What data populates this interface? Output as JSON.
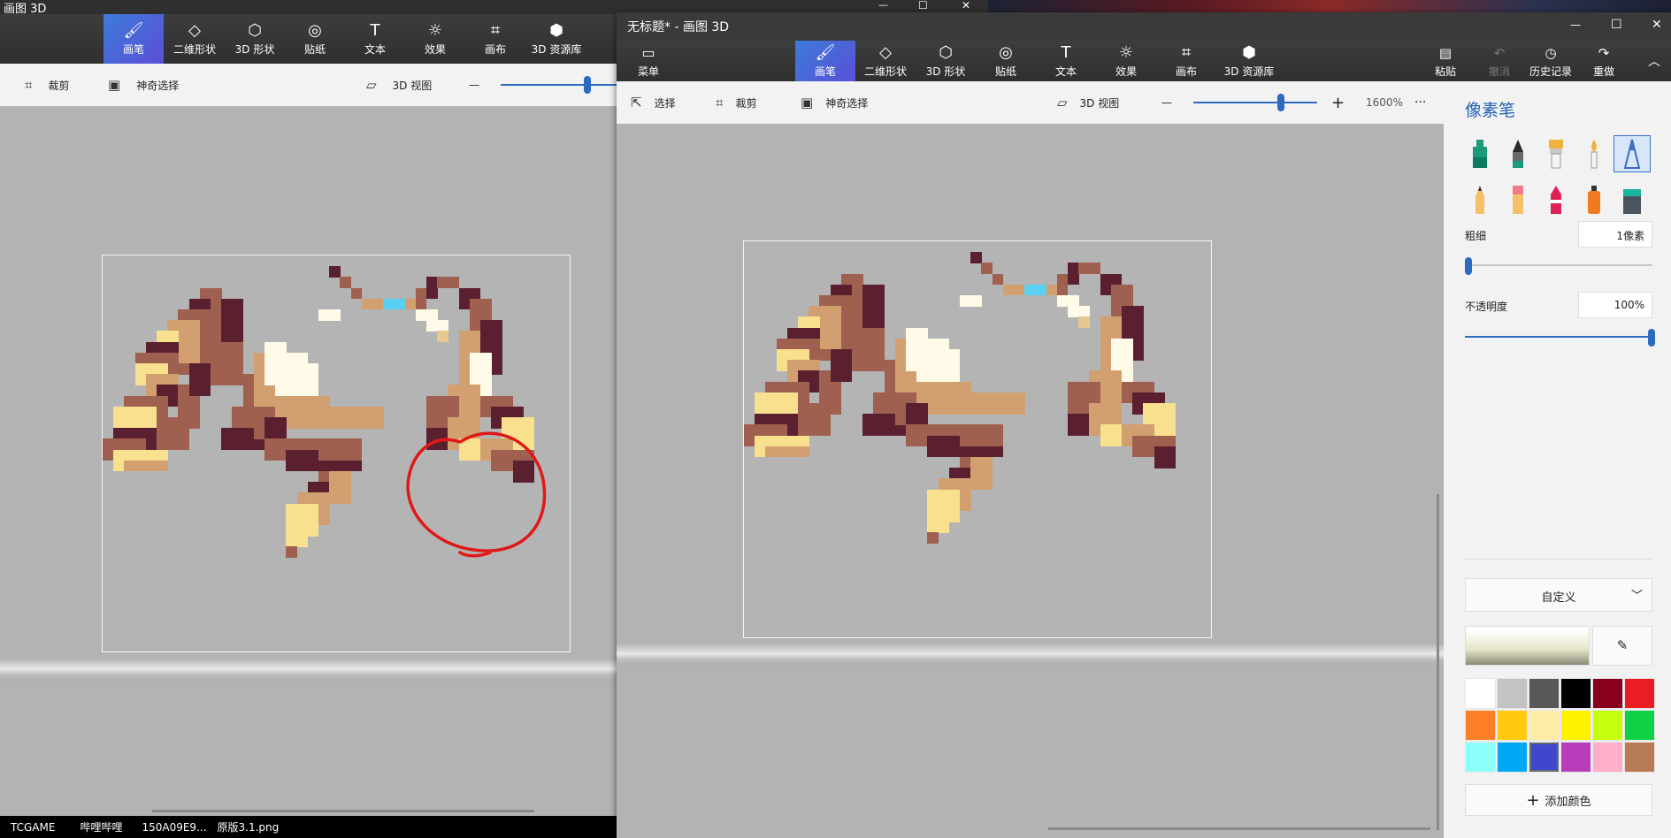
{
  "app_title_back": "画图 3D",
  "app_title_front": "无标题* - 画图 3D",
  "window_controls": {
    "minimize": "—",
    "maximize": "☐",
    "close": "✕"
  },
  "ribbon": {
    "menu_label": "菜单",
    "tools": [
      {
        "label": "画笔",
        "icon": "brush-icon"
      },
      {
        "label": "二维形状",
        "icon": "shapes-2d-icon"
      },
      {
        "label": "3D 形状",
        "icon": "cube-icon"
      },
      {
        "label": "贴纸",
        "icon": "sticker-icon"
      },
      {
        "label": "文本",
        "icon": "text-icon"
      },
      {
        "label": "效果",
        "icon": "effects-icon"
      },
      {
        "label": "画布",
        "icon": "canvas-icon"
      },
      {
        "label": "3D 资源库",
        "icon": "library-icon"
      }
    ],
    "right_tools": [
      {
        "label": "粘贴",
        "icon": "paste-icon"
      },
      {
        "label": "撤消",
        "icon": "undo-icon"
      },
      {
        "label": "历史记录",
        "icon": "history-icon"
      },
      {
        "label": "重做",
        "icon": "redo-icon"
      }
    ]
  },
  "subbar": {
    "select_label": "选择",
    "crop_label": "裁剪",
    "magic_select_label": "神奇选择",
    "view3d_label": "3D 视图",
    "zoom_minus": "—",
    "zoom_plus": "+",
    "zoom_level": "1600%",
    "more": "···"
  },
  "side_panel": {
    "title": "像素笔",
    "thickness_label": "粗细",
    "thickness_value": "1像素",
    "thickness_fraction": 0.0,
    "opacity_label": "不透明度",
    "opacity_value": "100%",
    "opacity_fraction": 1.0,
    "color_mode": "自定义",
    "add_color_label": "添加颜色",
    "palette": [
      "#ffffff",
      "#c3c3c3",
      "#585858",
      "#000000",
      "#88001b",
      "#ec1c24",
      "#ff7f27",
      "#ffc90e",
      "#fdeca6",
      "#fff200",
      "#c4ff0e",
      "#0ed145",
      "#8cfffb",
      "#00a8f3",
      "#3f48cc",
      "#b83dba",
      "#ffaec8",
      "#b97a56"
    ],
    "selected_color_index": 14
  },
  "taskbar": {
    "items": [
      "TCGAME",
      "哔哩哔哩",
      "150A09E9...",
      "原版3.1.png"
    ]
  },
  "colors": {
    "accent": "#3d7bd8",
    "annotation": "#e01818"
  }
}
